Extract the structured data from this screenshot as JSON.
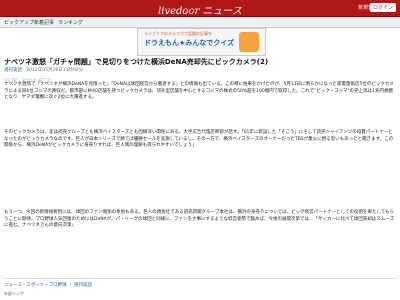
{
  "header": {
    "brand": "livedoor ニュース",
    "login": "ログイン",
    "signup": "新規登録"
  },
  "nav": [
    "ピックアップ",
    "新着記事",
    "ランキング"
  ],
  "banner": {
    "top": "ライブドアのメルマガで話題の記事を",
    "main": "ドラえもん★みんなでクイズ"
  },
  "article": {
    "title": "ナベツネ激怒「ガチャ問題」で見切りをつけた横浜DeNA売却先にビックカメラ(2)",
    "source": "週刊実話",
    "date": "2012年05月28日15時00分",
    "share": "いいね！ ツイート はてブ",
    "p1": "ナベツネ激怒で「ナベツネが横浜DeNAを見限った」「DeNAは球団経営から撤退する」との情報も出ている。この噂に拍車をかけたのが、5月11日に明らかになった家電量販店5位のビックカメラによる同6位コジマの買収だ。都市部に約40店舗を持つビックカメラは、郊外型店舗を中心とするコジマの株式の50%超を100億円で取得した。これで\"ビック・コジマ\"の売上高は1兆円規模となり、ヤマダ電機に次ぐ2位に大躍進する。",
    "p2": "そのビックカメラは、実は読売グループとも横浜ベイスターズとも因縁深い関係にある。大手広告代理店幹部が話す。「01年に新設した「そごう」にそして読売ジャイアンツの協賛パートナーとなったのがビックカメラなのです。巨人が日本シリーズで勝てば優勝セールを実施しているし、その一方で、横浜ベイスターズのオーナーだったTBSが業火に燃る思いもあったと聞きます。この関係から、横浜DeNAがビックカメラに身売りすれば、巨人側の理解も得られやすいでしょう」",
    "p3": "もう一つ、今回の新情報要因には、球団のファン増加の余地もある。巨人の親会社である読売新聞グループ本社は、横浜の身売りについては、ビッグ経営パートナーとしての役割を果たしてもらうことに期待。プロ野球人気回復のためにはDeNAが、パ・リーグの球団と同様に、ファンを大事にするような経営姿勢で臨めば、今後の展開次第では…「サッカーに比べて球団売却はスムーズに進む。ナベツネさんの意向次第」"
  },
  "tags": "ニュース・スポーツ・プロ野球 ・ 週刊実話",
  "sns": "外部リンク"
}
